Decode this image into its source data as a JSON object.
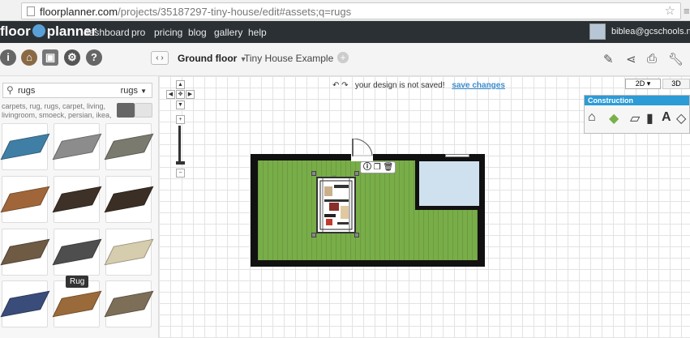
{
  "browser": {
    "url_domain": "floorplanner.com",
    "url_path": "/projects/35187297-tiny-house/edit#assets;q=rugs"
  },
  "header": {
    "logo_left": "floor",
    "logo_right": "planner",
    "nav": [
      "dashboard",
      "pro",
      "pricing",
      "blog",
      "gallery",
      "help"
    ],
    "user_email": "biblea@gcschools.net"
  },
  "toolbar": {
    "floor_label": "Ground floor",
    "project_label": "Tiny House Example"
  },
  "sidebar": {
    "search_query": "rugs",
    "category": "rugs",
    "tags": "carpets, rug, rugs, carpet, living, livingroom, smoeck, persian, ikea,",
    "tooltip": "Rug",
    "tile_colors": [
      "#3f7fa6",
      "#8c8c8c",
      "#7a7a6e",
      "#a0663a",
      "#3e3128",
      "#3b2f25",
      "#6f5a44",
      "#4e4e4e",
      "#d6ccae",
      "#3a4c7a",
      "#9a6a3a",
      "#7d6e58"
    ]
  },
  "canvas": {
    "status_text": "your design is not saved!",
    "save_label": "save changes",
    "mode_2d": "2D",
    "mode_3d": "3D",
    "construction_title": "Construction",
    "colors": {
      "floor": "#78ad48",
      "walls": "#111111",
      "bathroom": "#cfe1ee",
      "accent": "#2c9bd6"
    }
  }
}
